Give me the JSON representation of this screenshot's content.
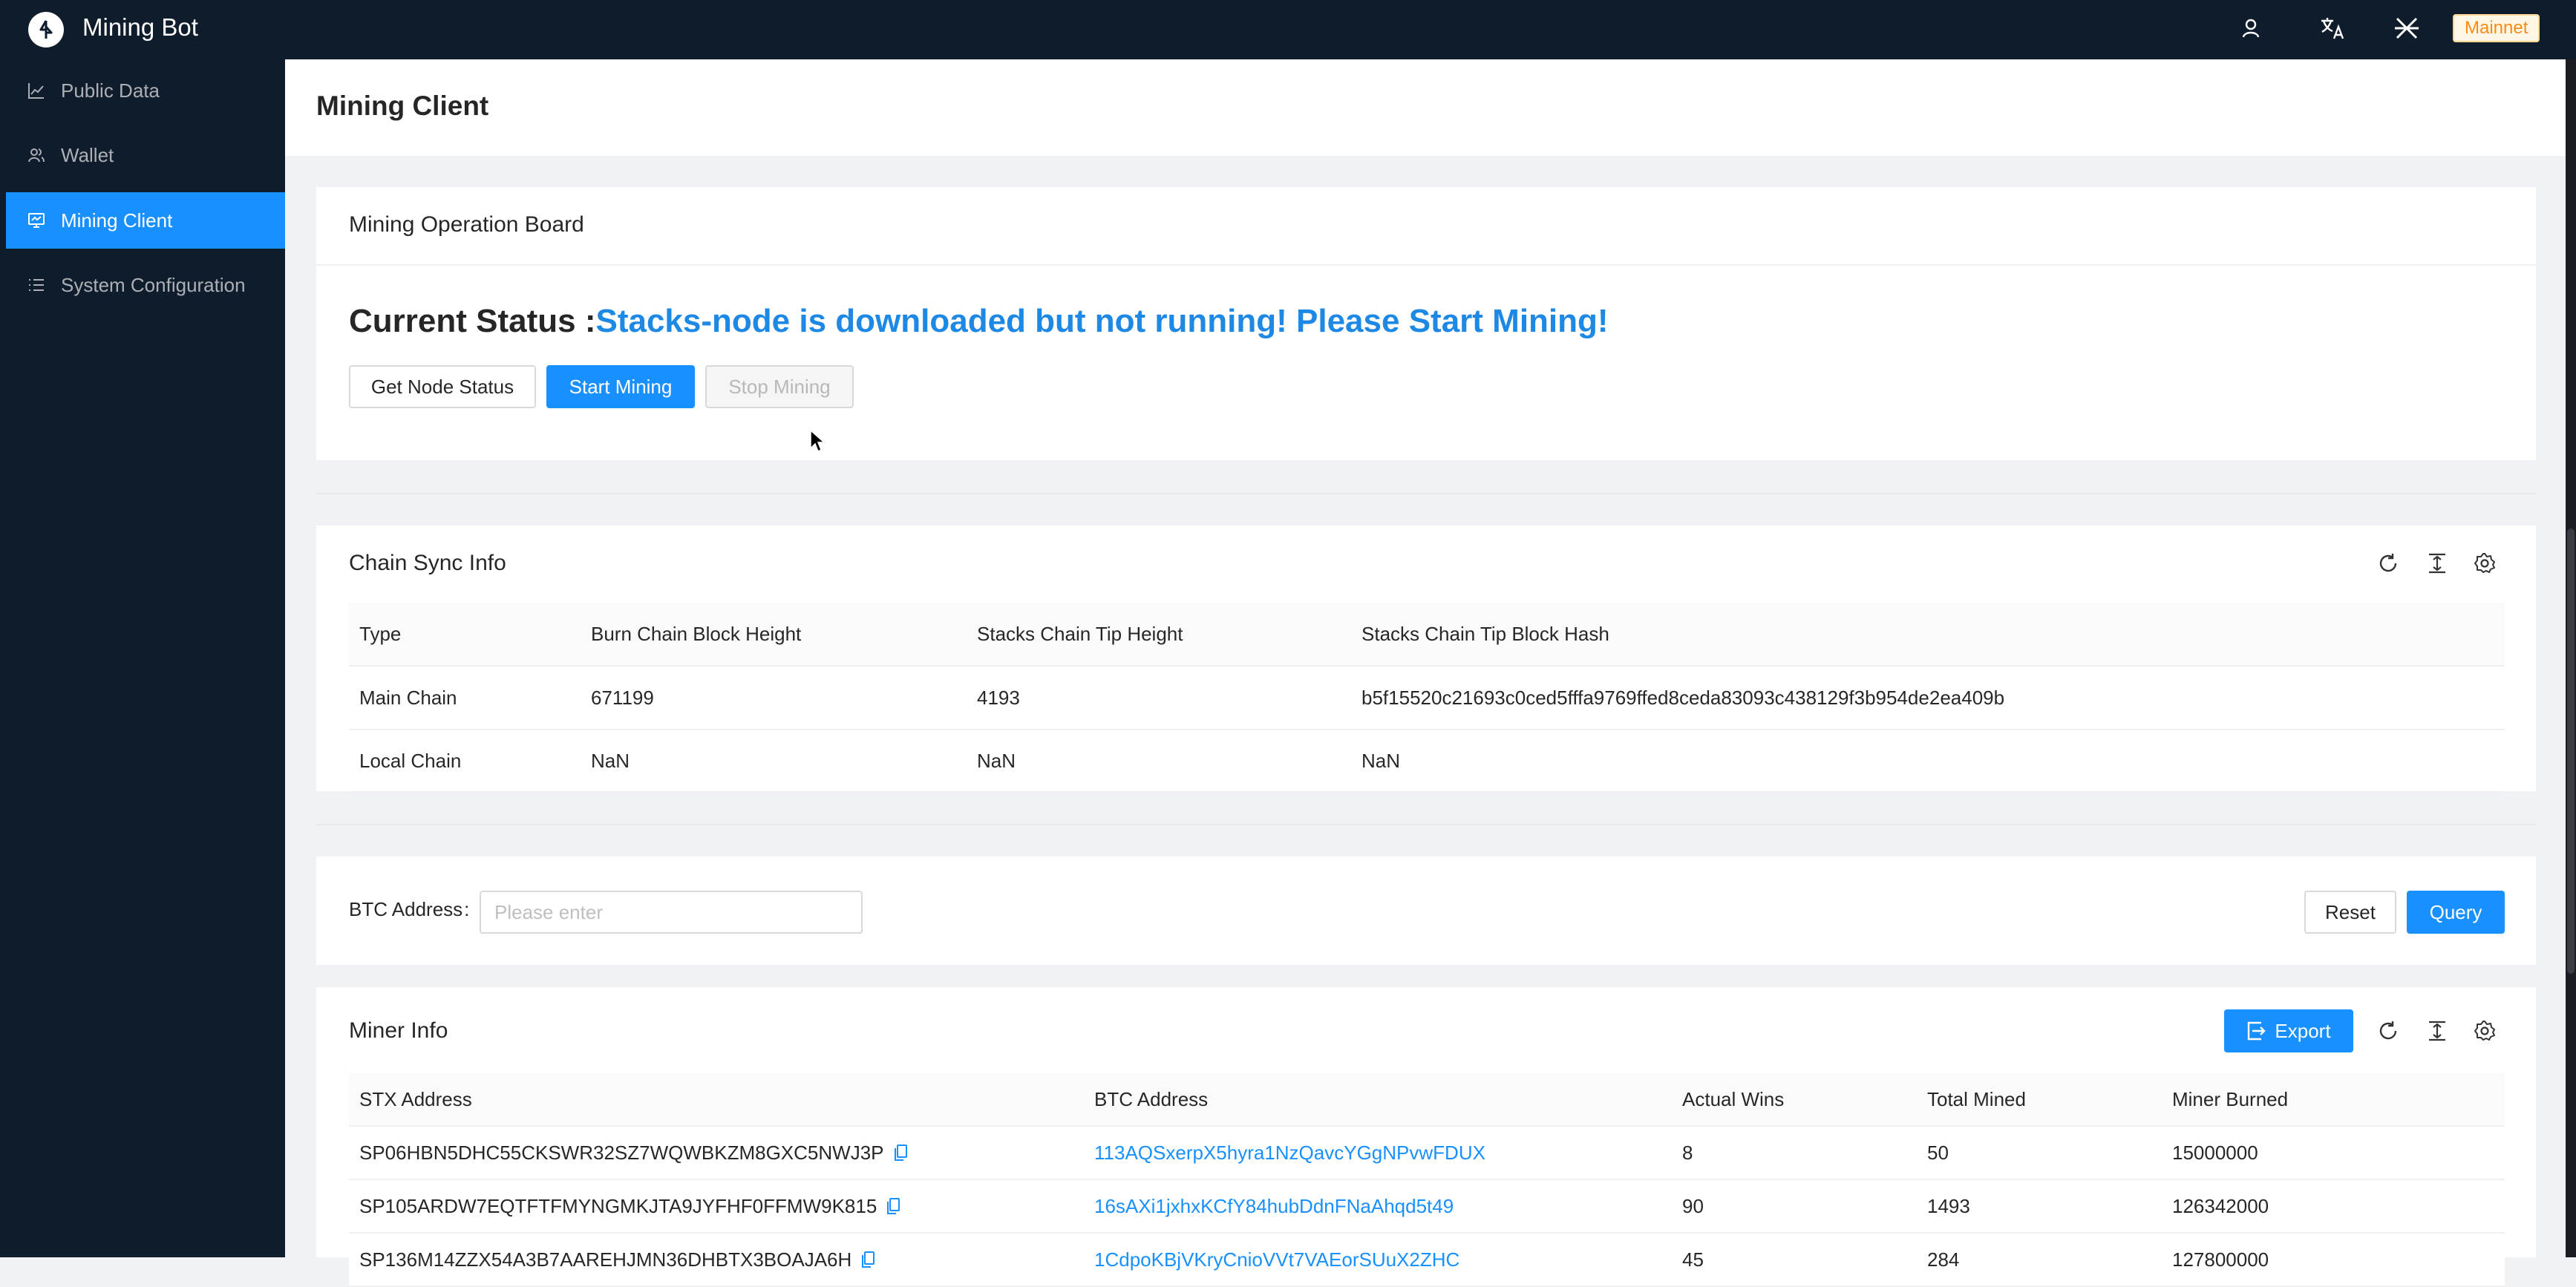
{
  "app": {
    "title": "Mining Bot",
    "network_badge": "Mainnet"
  },
  "header_icons": [
    "user-icon",
    "translate-icon",
    "network-icon"
  ],
  "sidebar": {
    "items": [
      {
        "label": "Public Data",
        "icon": "line-chart-icon",
        "active": false
      },
      {
        "label": "Wallet",
        "icon": "users-icon",
        "active": false
      },
      {
        "label": "Mining Client",
        "icon": "monitor-icon",
        "active": true
      },
      {
        "label": "System Configuration",
        "icon": "list-icon",
        "active": false
      }
    ]
  },
  "page": {
    "title": "Mining Client"
  },
  "operation_board": {
    "title": "Mining Operation Board",
    "status_prefix": "Current Status :",
    "status_message": "Stacks-node is downloaded but not running! Please Start Mining!",
    "buttons": {
      "node_status": "Get Node Status",
      "start": "Start Mining",
      "stop": "Stop Mining"
    }
  },
  "chain_sync": {
    "title": "Chain Sync Info",
    "columns": [
      "Type",
      "Burn Chain Block Height",
      "Stacks Chain Tip Height",
      "Stacks Chain Tip Block Hash"
    ],
    "rows": [
      [
        "Main Chain",
        "671199",
        "4193",
        "b5f15520c21693c0ced5fffa9769ffed8ceda83093c438129f3b954de2ea409b"
      ],
      [
        "Local Chain",
        "NaN",
        "NaN",
        "NaN"
      ]
    ]
  },
  "search": {
    "label": "BTC Address",
    "colon": ":",
    "placeholder": "Please enter",
    "reset": "Reset",
    "query": "Query"
  },
  "miner_info": {
    "title": "Miner Info",
    "export": "Export",
    "columns": [
      "STX Address",
      "BTC Address",
      "Actual Wins",
      "Total Mined",
      "Miner Burned"
    ],
    "rows": [
      [
        "SP06HBN5DHC55CKSWR32SZ7WQWBKZM8GXC5NWJ3P",
        "113AQSxerpX5hyra1NzQavcYGgNPvwFDUX",
        "8",
        "50",
        "15000000"
      ],
      [
        "SP105ARDW7EQTFTFMYNGMKJTA9JYFHF0FFMW9K815",
        "16sAXi1jxhxKCfY84hubDdnFNaAhqd5t49",
        "90",
        "1493",
        "126342000"
      ],
      [
        "SP136M14ZZX54A3B7AAREHJMN36DHBTX3BOAJA6H",
        "1CdpoKBjVKryCnioVVt7VAEorSUuX2ZHC",
        "45",
        "284",
        "127800000"
      ]
    ]
  },
  "colors": {
    "sidebar_bg": "#0f1c2b",
    "primary": "#1890ff",
    "status_text": "#1e88e5",
    "badge": "#fa8c16"
  }
}
